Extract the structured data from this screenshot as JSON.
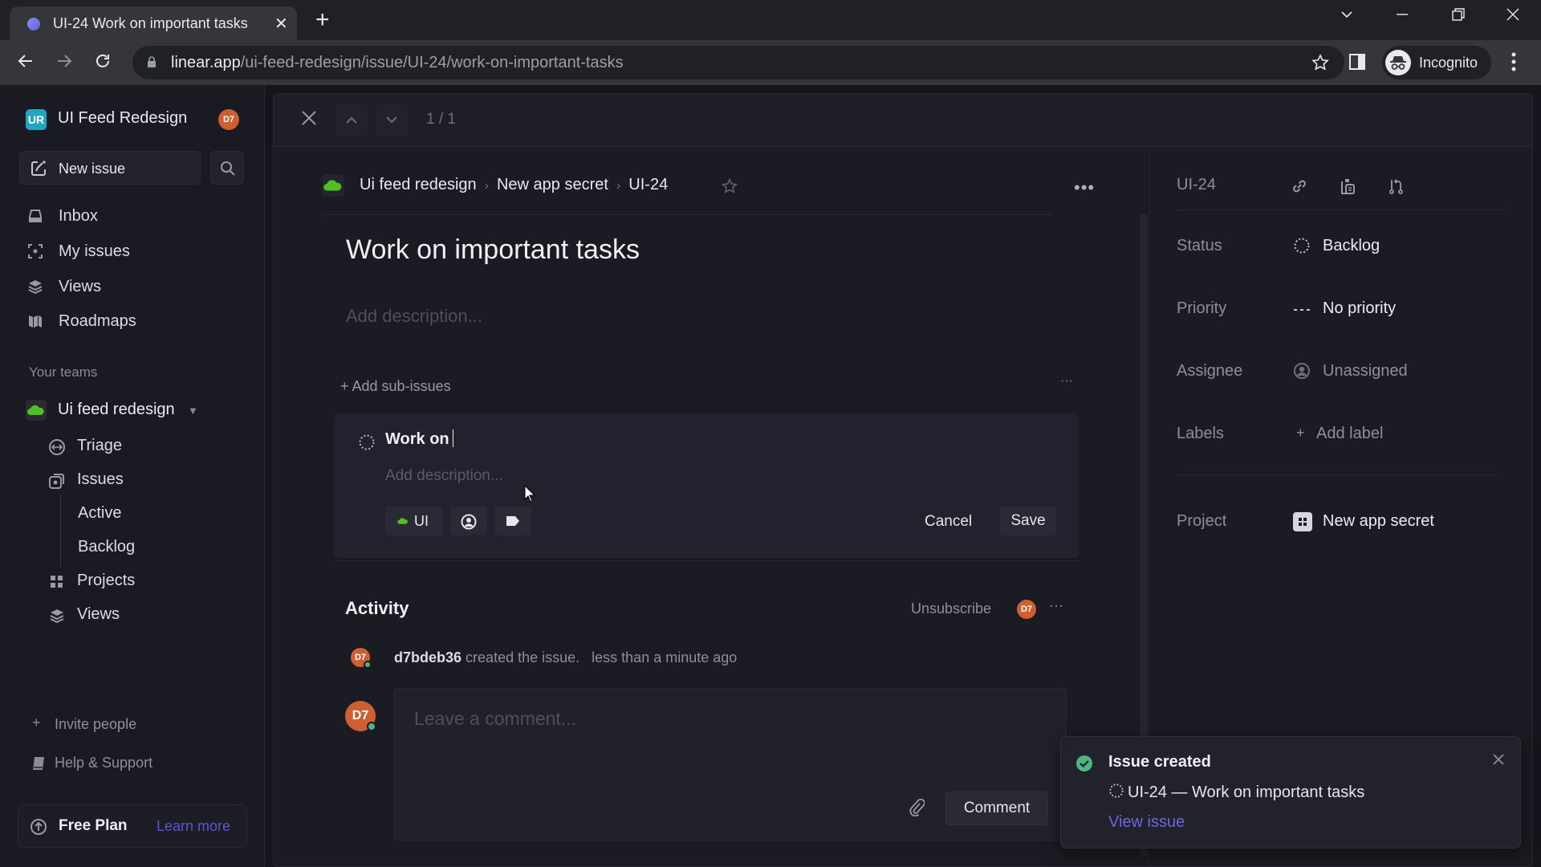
{
  "browser": {
    "tab_title": "UI-24 Work on important tasks",
    "url_domain": "linear.app",
    "url_path": "/ui-feed-redesign/issue/UI-24/work-on-important-tasks",
    "profile_label": "Incognito"
  },
  "sidebar": {
    "workspace_initials": "UR",
    "workspace_name": "UI Feed Redesign",
    "user_initials": "D7",
    "new_issue_label": "New issue",
    "nav": [
      {
        "label": "Inbox",
        "icon": "inbox-icon"
      },
      {
        "label": "My issues",
        "icon": "my-issues-icon"
      },
      {
        "label": "Views",
        "icon": "views-icon"
      },
      {
        "label": "Roadmaps",
        "icon": "roadmap-icon"
      }
    ],
    "teams_heading": "Your teams",
    "team_name": "Ui feed redesign",
    "team_items": [
      {
        "label": "Triage",
        "icon": "triage-icon"
      },
      {
        "label": "Issues",
        "icon": "issues-icon"
      },
      {
        "label": "Active",
        "icon": ""
      },
      {
        "label": "Backlog",
        "icon": ""
      },
      {
        "label": "Projects",
        "icon": "projects-icon"
      },
      {
        "label": "Views",
        "icon": "views-icon"
      }
    ],
    "invite_label": "Invite people",
    "help_label": "Help & Support",
    "plan_label": "Free Plan",
    "learn_more_label": "Learn more"
  },
  "panel": {
    "counter": "1 / 1",
    "breadcrumb": [
      "Ui feed redesign",
      "New app secret",
      "UI-24"
    ],
    "issue_title": "Work on important tasks",
    "description_placeholder": "Add description...",
    "add_sub_issues_label": "+ Add sub-issues",
    "sub_issue_form": {
      "title_value": "Work on",
      "description_placeholder": "Add description...",
      "team_chip_label": "UI",
      "cancel_label": "Cancel",
      "save_label": "Save"
    },
    "activity": {
      "heading": "Activity",
      "unsubscribe_label": "Unsubscribe",
      "subscriber_initials": "D7",
      "event_user": "d7bdeb36",
      "event_text": "created the issue.",
      "event_time": "less than a minute ago",
      "comment_placeholder": "Leave a comment...",
      "comment_button_label": "Comment",
      "commenter_initials": "D7"
    }
  },
  "properties": {
    "issue_id": "UI-24",
    "rows": [
      {
        "label": "Status",
        "value": "Backlog"
      },
      {
        "label": "Priority",
        "value": "No priority"
      },
      {
        "label": "Assignee",
        "value": "Unassigned"
      },
      {
        "label": "Labels",
        "value": "Add label"
      },
      {
        "label": "Project",
        "value": "New app secret"
      }
    ]
  },
  "toast": {
    "title": "Issue created",
    "message": "UI-24 — Work on important tasks",
    "action_label": "View issue"
  },
  "colors": {
    "accent": "#5e5ce6",
    "team_green": "#4fbf26",
    "avatar_orange": "#cd5f33",
    "success_green": "#4cb782"
  }
}
